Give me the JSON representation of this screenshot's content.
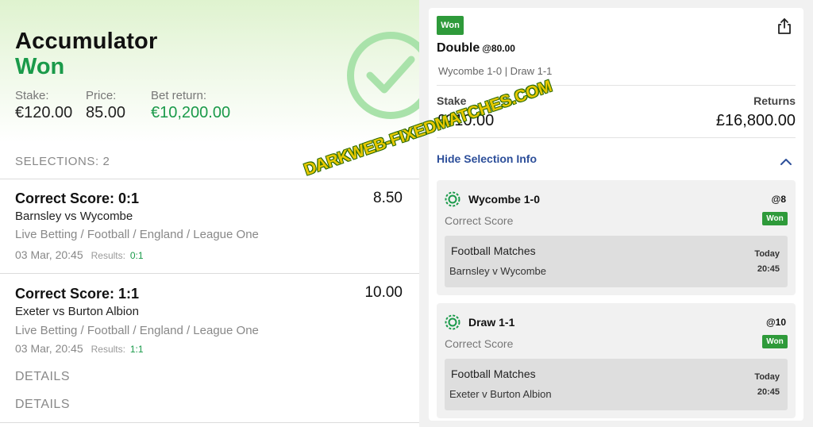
{
  "left": {
    "title": "Accumulator",
    "status": "Won",
    "stake_label": "Stake:",
    "stake_value": "€120.00",
    "price_label": "Price:",
    "price_value": "85.00",
    "return_label": "Bet return:",
    "return_value": "€10,200.00",
    "selections_label": "SELECTIONS: 2",
    "selections": [
      {
        "title": "Correct Score: 0:1",
        "odds": "8.50",
        "match": "Barnsley vs Wycombe",
        "path": "Live Betting / Football / England / League One",
        "date": "03 Mar, 20:45",
        "results_label": "Results:",
        "results_value": "0:1"
      },
      {
        "title": "Correct Score: 1:1",
        "odds": "10.00",
        "match": "Exeter vs Burton Albion",
        "path": "Live Betting / Football / England / League One",
        "date": "03 Mar, 20:45",
        "results_label": "Results:",
        "results_value": "1:1"
      }
    ],
    "details_1": "DETAILS",
    "details_2": "DETAILS"
  },
  "watermark": "DARKWEB-FIXEDMATCHES.COM",
  "right": {
    "badge": "Won",
    "bet_type": "Double",
    "bet_price": "@80.00",
    "legs_summary": "Wycombe 1-0 | Draw 1-1",
    "stake_label": "Stake",
    "stake_value": "£210.00",
    "returns_label": "Returns",
    "returns_value": "£16,800.00",
    "hide_info": "Hide Selection Info",
    "legs": [
      {
        "name": "Wycombe 1-0",
        "odds": "@8",
        "market": "Correct Score",
        "status": "Won",
        "competition": "Football Matches",
        "event": "Barnsley v Wycombe",
        "day": "Today",
        "time": "20:45"
      },
      {
        "name": "Draw 1-1",
        "odds": "@10",
        "market": "Correct Score",
        "status": "Won",
        "competition": "Football Matches",
        "event": "Exeter v Burton Albion",
        "day": "Today",
        "time": "20:45"
      }
    ]
  },
  "colors": {
    "brand_green": "#1a9a4a",
    "badge_green": "#2e9a3a",
    "link_blue": "#2d4f9a"
  }
}
